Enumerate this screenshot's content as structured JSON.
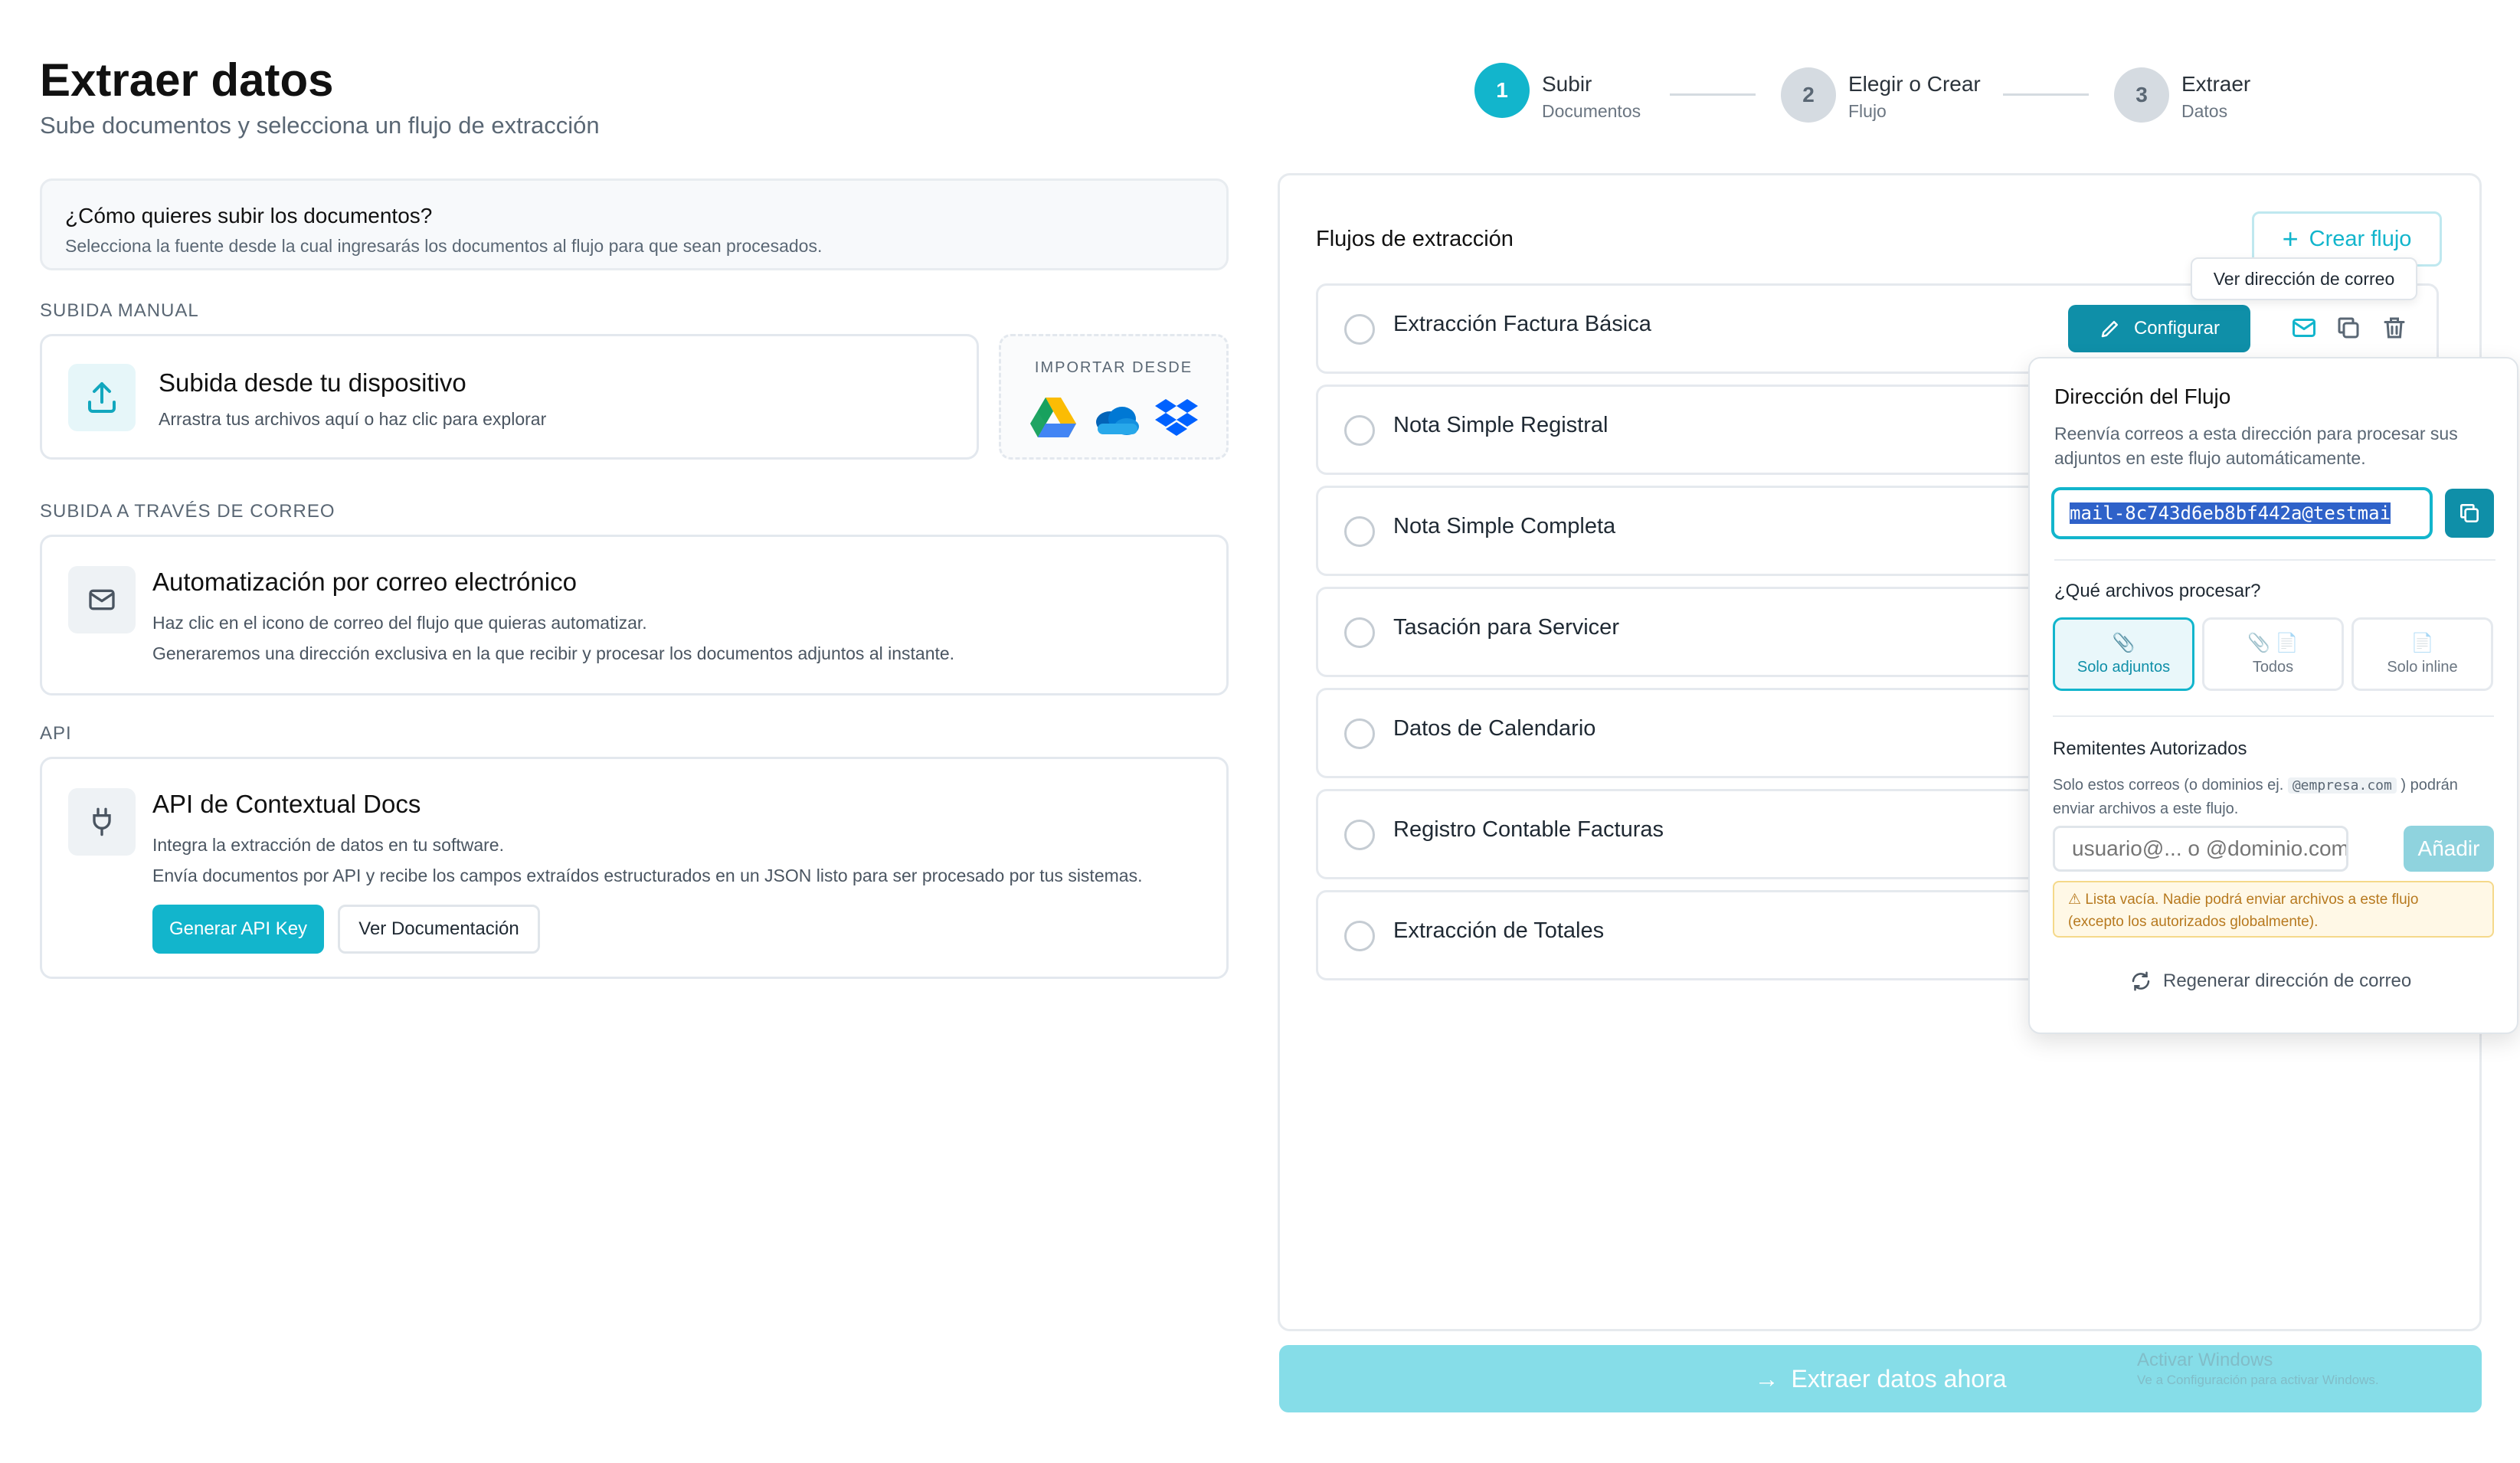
{
  "page": {
    "title": "Extraer datos",
    "subtitle": "Sube documentos y selecciona un flujo de extracción"
  },
  "steps": [
    {
      "num": "1",
      "title": "Subir",
      "sub": "Documentos"
    },
    {
      "num": "2",
      "title": "Elegir o Crear",
      "sub": "Flujo"
    },
    {
      "num": "3",
      "title": "Extraer",
      "sub": "Datos"
    }
  ],
  "question": {
    "title": "¿Cómo quieres subir los documentos?",
    "desc": "Selecciona la fuente desde la cual ingresarás los documentos al flujo para que sean procesados."
  },
  "manual": {
    "label": "Subida manual",
    "title": "Subida desde tu dispositivo",
    "desc": "Arrastra tus archivos aquí o haz clic para explorar",
    "import_label": "IMPORTAR DESDE"
  },
  "email": {
    "label": "Subida a través de correo",
    "title": "Automatización por correo electrónico",
    "desc1": "Haz clic en el icono de correo del flujo que quieras automatizar.",
    "desc2": "Generaremos una dirección exclusiva en la que recibir y procesar los documentos adjuntos al instante."
  },
  "api": {
    "label": "API",
    "title": "API de Contextual Docs",
    "desc1": "Integra la extracción de datos en tu software.",
    "desc2": "Envía documentos por API y recibe los campos extraídos estructurados en un JSON listo para ser procesado por tus sistemas.",
    "btn_key": "Generar API Key",
    "btn_docs": "Ver Documentación"
  },
  "flows": {
    "title": "Flujos de extracción",
    "create": "Crear flujo",
    "configure": "Configurar",
    "tooltip": "Ver dirección de correo",
    "items": [
      "Extracción Factura Básica",
      "Nota Simple Registral",
      "Nota Simple Completa",
      "Tasación para Servicer",
      "Datos de Calendario",
      "Registro Contable Facturas",
      "Extracción de Totales"
    ]
  },
  "popover": {
    "title": "Dirección del Flujo",
    "desc": "Reenvía correos a esta dirección para procesar sus adjuntos en este flujo automáticamente.",
    "email_value": "mail-8c743d6eb8bf442a@testmai",
    "files_title": "¿Qué archivos procesar?",
    "options": [
      "Solo adjuntos",
      "Todos",
      "Solo inline"
    ],
    "senders_title": "Remitentes Autorizados",
    "senders_desc1": "Solo estos correos (o dominios ej.",
    "senders_domain": "@empresa.com",
    "senders_desc2": ") podrán",
    "senders_desc3": "enviar archivos a este flujo.",
    "input_placeholder": "usuario@... o @dominio.com",
    "add": "Añadir",
    "warning1": "Lista vacía. Nadie podrá enviar archivos a este flujo",
    "warning2": "(excepto los autorizados globalmente).",
    "regen": "Regenerar dirección de correo"
  },
  "cta": {
    "label": "Extraer datos ahora"
  },
  "watermark": {
    "line1": "Activar Windows",
    "line2": "Ve a Configuración para activar Windows."
  },
  "colors": {
    "accent": "#12b5cc",
    "accent_dark": "#0f8fa8"
  }
}
